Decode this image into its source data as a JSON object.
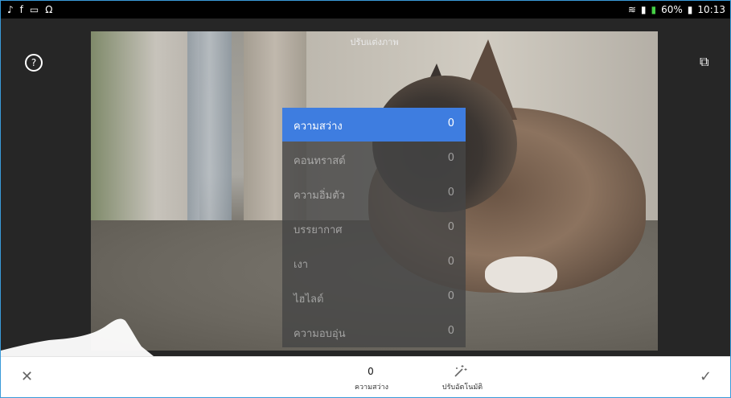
{
  "status_bar": {
    "battery": "60%",
    "time": "10:13"
  },
  "editor": {
    "title": "ปรับแต่งภาพ",
    "menu": [
      {
        "label": "ความสว่าง",
        "value": "0",
        "active": true
      },
      {
        "label": "คอนทราสต์",
        "value": "0",
        "active": false
      },
      {
        "label": "ความอิ่มตัว",
        "value": "0",
        "active": false
      },
      {
        "label": "บรรยากาศ",
        "value": "0",
        "active": false
      },
      {
        "label": "เงา",
        "value": "0",
        "active": false
      },
      {
        "label": "ไฮไลต์",
        "value": "0",
        "active": false
      },
      {
        "label": "ความอบอุ่น",
        "value": "0",
        "active": false
      }
    ],
    "accent_color": "#3e7de0"
  },
  "toolbar": {
    "close_glyph": "✕",
    "confirm_glyph": "✓",
    "current_value": "0",
    "current_label": "ความสว่าง",
    "auto_label": "ปรับอัตโนมัติ"
  },
  "icons": {
    "status_left": [
      "music-icon",
      "facebook-icon",
      "gallery-icon",
      "headphones-icon"
    ],
    "status_right": [
      "wifi-icon",
      "signal-icon",
      "signal-icon",
      "battery-icon"
    ],
    "help": "help-icon",
    "compare": "compare-icon",
    "auto": "magic-wand-icon"
  }
}
